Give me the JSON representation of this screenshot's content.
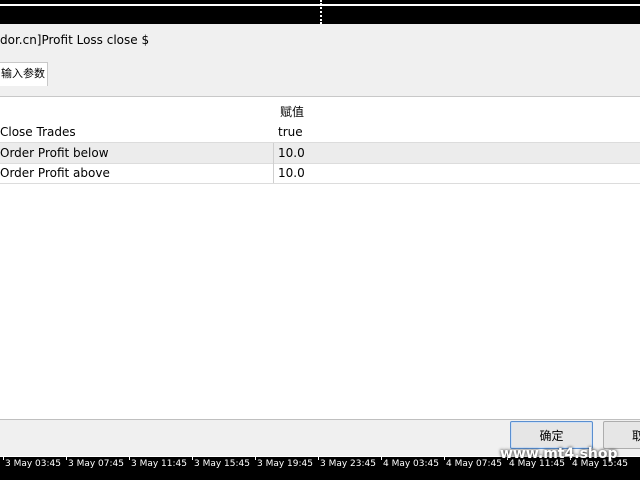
{
  "window": {
    "title": "dor.cn]Profit Loss close $"
  },
  "tabs": [
    {
      "label": "输入参数"
    }
  ],
  "table": {
    "value_header": "赋值",
    "rows": [
      {
        "name": "Close Trades",
        "value": "true"
      },
      {
        "name": "Order Profit below",
        "value": "10.0"
      },
      {
        "name": "Order Profit above",
        "value": "10.0"
      }
    ]
  },
  "buttons": {
    "ok": "确定",
    "cancel": "取"
  },
  "chart_axis": {
    "labels": [
      "3 May 03:45",
      "3 May 07:45",
      "3 May 11:45",
      "3 May 15:45",
      "3 May 19:45",
      "3 May 23:45",
      "4 May 03:45",
      "4 May 07:45",
      "4 May 11:45",
      "4 May 15:45"
    ]
  },
  "watermark": "www.mt4.shop"
}
